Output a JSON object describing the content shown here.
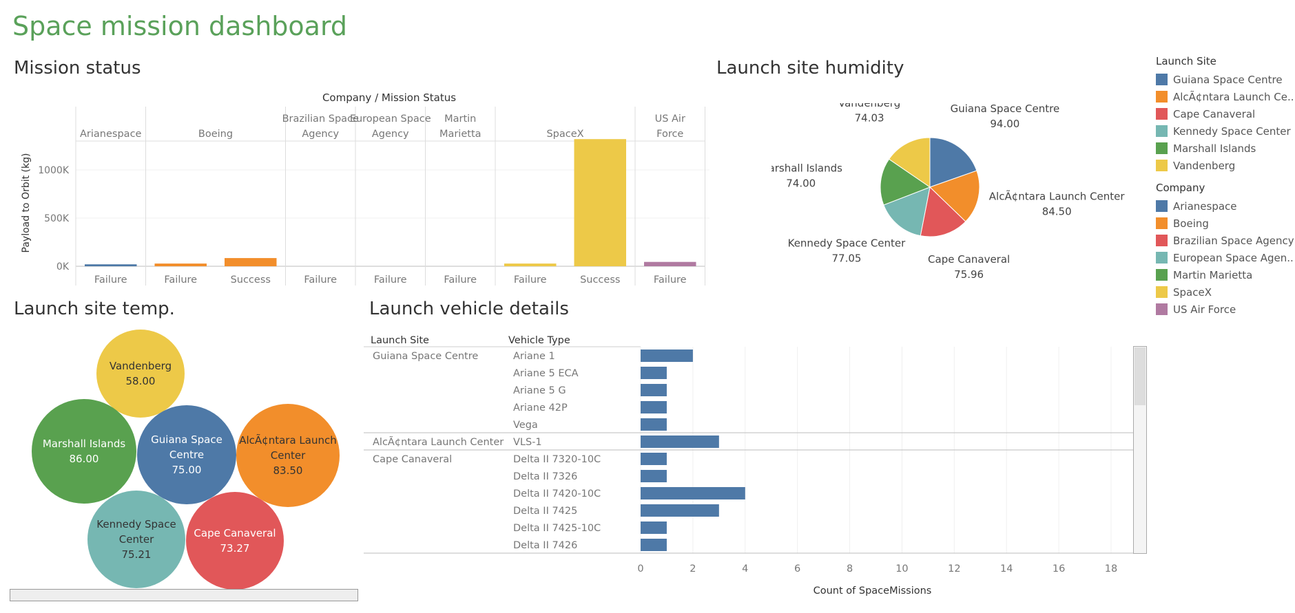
{
  "dashboard": {
    "title": "Space mission dashboard"
  },
  "sections": {
    "mission_status": "Mission status",
    "humidity": "Launch site humidity",
    "temp": "Launch site temp.",
    "vehicle": "Launch vehicle details"
  },
  "legends": {
    "launch_site": {
      "title": "Launch Site",
      "items": [
        {
          "label": "Guiana Space Centre",
          "color": "#4e79a7"
        },
        {
          "label": "AlcÃ¢ntara Launch Ce..",
          "color": "#f28e2b"
        },
        {
          "label": "Cape Canaveral",
          "color": "#e15759"
        },
        {
          "label": "Kennedy Space Center",
          "color": "#76b7b2"
        },
        {
          "label": "Marshall Islands",
          "color": "#59a14f"
        },
        {
          "label": "Vandenberg",
          "color": "#edc948"
        }
      ]
    },
    "company": {
      "title": "Company",
      "items": [
        {
          "label": "Arianespace",
          "color": "#4e79a7"
        },
        {
          "label": "Boeing",
          "color": "#f28e2b"
        },
        {
          "label": "Brazilian Space Agency",
          "color": "#e15759"
        },
        {
          "label": "European Space Agen..",
          "color": "#76b7b2"
        },
        {
          "label": "Martin Marietta",
          "color": "#59a14f"
        },
        {
          "label": "SpaceX",
          "color": "#edc948"
        },
        {
          "label": "US Air Force",
          "color": "#b07aa1"
        }
      ]
    }
  },
  "chart_data": [
    {
      "type": "bar",
      "title": "Company / Mission Status",
      "ylabel": "Payload to Orbit (kg)",
      "yticks": [
        "0K",
        "500K",
        "1000K"
      ],
      "ylim": [
        0,
        1300000
      ],
      "companies": [
        {
          "name": "Arianespace",
          "color": "#4e79a7",
          "statuses": [
            {
              "label": "Failure",
              "value": 20000
            }
          ]
        },
        {
          "name": "Boeing",
          "color": "#f28e2b",
          "statuses": [
            {
              "label": "Failure",
              "value": 28000
            },
            {
              "label": "Success",
              "value": 85000
            }
          ]
        },
        {
          "name": "Brazilian Space Agency",
          "color": "#e15759",
          "statuses": [
            {
              "label": "Failure",
              "value": 0
            }
          ]
        },
        {
          "name": "European Space Agency",
          "color": "#76b7b2",
          "statuses": [
            {
              "label": "Failure",
              "value": 0
            }
          ]
        },
        {
          "name": "Martin Marietta",
          "color": "#59a14f",
          "statuses": [
            {
              "label": "Failure",
              "value": 0
            }
          ]
        },
        {
          "name": "SpaceX",
          "color": "#edc948",
          "statuses": [
            {
              "label": "Failure",
              "value": 28000
            },
            {
              "label": "Success",
              "value": 1320000
            }
          ]
        },
        {
          "name": "US Air Force",
          "color": "#b07aa1",
          "statuses": [
            {
              "label": "Failure",
              "value": 45000
            }
          ]
        }
      ]
    },
    {
      "type": "pie",
      "slices": [
        {
          "label": "Guiana Space Centre",
          "value": "94.00",
          "color": "#4e79a7"
        },
        {
          "label": "AlcÃ¢ntara Launch Center",
          "value": "84.50",
          "color": "#f28e2b"
        },
        {
          "label": "Cape Canaveral",
          "value": "75.96",
          "color": "#e15759"
        },
        {
          "label": "Kennedy Space Center",
          "value": "77.05",
          "color": "#76b7b2"
        },
        {
          "label": "Marshall Islands",
          "value": "74.00",
          "color": "#59a14f"
        },
        {
          "label": "Vandenberg",
          "value": "74.03",
          "color": "#edc948"
        }
      ]
    },
    {
      "type": "bubble",
      "bubbles": [
        {
          "label": "Vandenberg",
          "value": "58.00",
          "color": "#edc948",
          "dark": true
        },
        {
          "label": "Marshall Islands",
          "value": "86.00",
          "color": "#59a14f",
          "dark": false
        },
        {
          "label": "Guiana Space Centre",
          "value": "75.00",
          "color": "#4e79a7",
          "dark": false
        },
        {
          "label": "AlcÃ¢ntara Launch Center",
          "value": "83.50",
          "color": "#f28e2b",
          "dark": true
        },
        {
          "label": "Kennedy Space Center",
          "value": "75.21",
          "color": "#76b7b2",
          "dark": true
        },
        {
          "label": "Cape Canaveral",
          "value": "73.27",
          "color": "#e15759",
          "dark": false
        }
      ]
    },
    {
      "type": "bar",
      "orientation": "horizontal",
      "col_headers": [
        "Launch Site",
        "Vehicle Type"
      ],
      "xlabel": "Count of SpaceMissions",
      "xticks": [
        0,
        2,
        4,
        6,
        8,
        10,
        12,
        14,
        16,
        18
      ],
      "xlim": [
        0,
        18
      ],
      "color": "#4e79a7",
      "groups": [
        {
          "site": "Guiana Space Centre",
          "rows": [
            {
              "vehicle": "Ariane 1",
              "count": 2
            },
            {
              "vehicle": "Ariane 5 ECA",
              "count": 1
            },
            {
              "vehicle": "Ariane 5 G",
              "count": 1
            },
            {
              "vehicle": "Ariane 42P",
              "count": 1
            },
            {
              "vehicle": "Vega",
              "count": 1
            }
          ]
        },
        {
          "site": "AlcÃ¢ntara Launch Center",
          "rows": [
            {
              "vehicle": "VLS-1",
              "count": 3
            }
          ]
        },
        {
          "site": "Cape Canaveral",
          "rows": [
            {
              "vehicle": "Delta II 7320-10C",
              "count": 1
            },
            {
              "vehicle": "Delta II 7326",
              "count": 1
            },
            {
              "vehicle": "Delta II 7420-10C",
              "count": 4
            },
            {
              "vehicle": "Delta II 7425",
              "count": 3
            },
            {
              "vehicle": "Delta II 7425-10C",
              "count": 1
            },
            {
              "vehicle": "Delta II 7426",
              "count": 1
            }
          ]
        }
      ]
    }
  ]
}
